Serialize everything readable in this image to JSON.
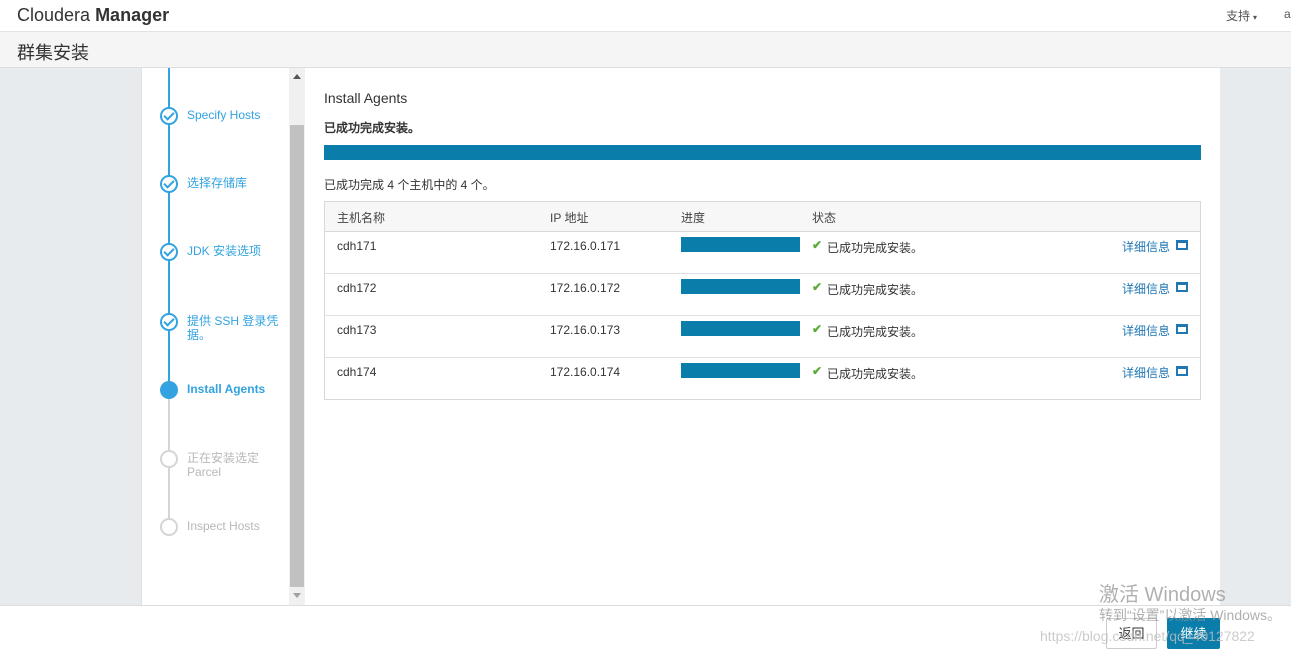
{
  "header": {
    "brand_light": "Cloudera",
    "brand_bold": "Manager",
    "support_label": "支持",
    "user_label": "a"
  },
  "title": "群集安装",
  "steps": [
    {
      "label": "Specify Hosts",
      "status": "done"
    },
    {
      "label": "选择存储库",
      "status": "done"
    },
    {
      "label": "JDK 安装选项",
      "status": "done"
    },
    {
      "label": "提供 SSH 登录凭据。",
      "status": "done"
    },
    {
      "label": "Install Agents",
      "status": "active"
    },
    {
      "label": "正在安装选定 Parcel",
      "status": "todo"
    },
    {
      "label": "Inspect Hosts",
      "status": "todo"
    }
  ],
  "main": {
    "heading": "Install Agents",
    "success_text": "已成功完成安装。",
    "overall_progress": 1.0,
    "summary": "已成功完成 4 个主机中的 4 个。"
  },
  "table": {
    "columns": [
      "主机名称",
      "IP 地址",
      "进度",
      "状态"
    ],
    "rows": [
      {
        "host": "cdh171",
        "ip": "172.16.0.171",
        "progress": 1.0,
        "status": "已成功完成安装。",
        "detail": "详细信息"
      },
      {
        "host": "cdh172",
        "ip": "172.16.0.172",
        "progress": 1.0,
        "status": "已成功完成安装。",
        "detail": "详细信息"
      },
      {
        "host": "cdh173",
        "ip": "172.16.0.173",
        "progress": 1.0,
        "status": "已成功完成安装。",
        "detail": "详细信息"
      },
      {
        "host": "cdh174",
        "ip": "172.16.0.174",
        "progress": 1.0,
        "status": "已成功完成安装。",
        "detail": "详细信息"
      }
    ]
  },
  "footer": {
    "back_label": "返回",
    "next_label": "继续"
  },
  "watermark": {
    "activate_title": "激活 Windows",
    "activate_sub": "转到“设置”以激活 Windows。",
    "url": "https://blog.csdn.net/qq_40127822"
  },
  "colors": {
    "accent": "#32a3e0",
    "progress": "#0a7dab",
    "success_check": "#5cab3a",
    "link": "#1f77b4"
  },
  "icons": {
    "step_done": "check-circle-icon",
    "step_active": "filled-circle-icon",
    "step_todo": "empty-circle-icon",
    "row_status": "check-icon",
    "row_detail": "window-icon",
    "support_menu": "caret-down-icon"
  }
}
